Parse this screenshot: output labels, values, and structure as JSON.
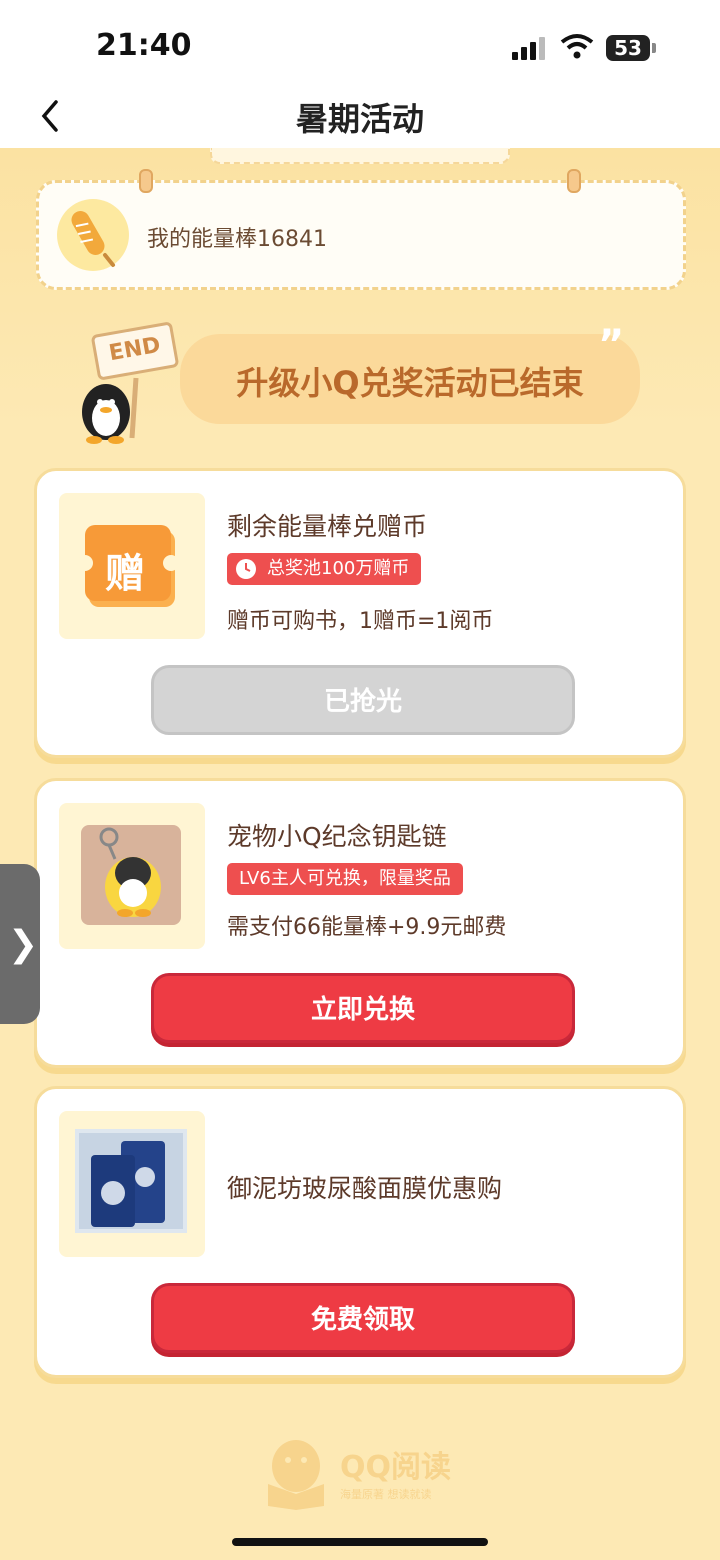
{
  "status": {
    "time": "21:40",
    "battery": "53"
  },
  "nav": {
    "title": "暑期活动"
  },
  "energy": {
    "label": "我的能量棒16841"
  },
  "banner": {
    "end_sign": "END",
    "text": "升级小Q兑奖活动已结束"
  },
  "rewards": [
    {
      "thumb_char": "赠",
      "title": "剩余能量棒兑赠币",
      "tag": "总奖池100万赠币",
      "desc": "赠币可购书，1赠币=1阅币",
      "button": "已抢光"
    },
    {
      "title": "宠物小Q纪念钥匙链",
      "tag": "LV6主人可兑换，限量奖品",
      "desc": "需支付66能量棒+9.9元邮费",
      "button": "立即兑换"
    },
    {
      "title": "御泥坊玻尿酸面膜优惠购",
      "button": "免费领取"
    }
  ],
  "footer": {
    "logo_text": "QQ阅读",
    "slogan": "海量原著  想读就读"
  },
  "colors": {
    "accent_red": "#ee3b44",
    "background": "#fde9b4",
    "text_brown": "#6b4b33"
  }
}
